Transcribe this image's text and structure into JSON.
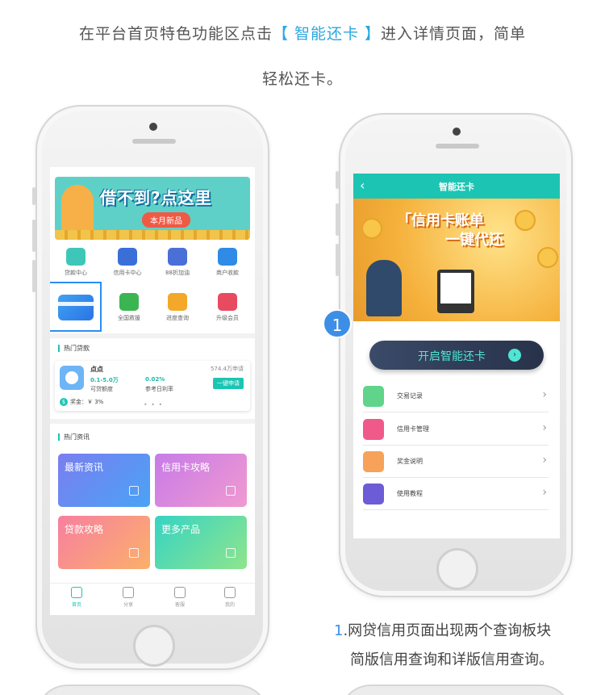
{
  "intro": {
    "line1_prefix": "在平台首页特色功能区点击",
    "line1_highlight": "【 智能还卡 】",
    "line1_suffix": "进入详情页面，简单",
    "line2": "轻松还卡。"
  },
  "phone1": {
    "banner": {
      "title": "借不到?点这里",
      "badge": "本月新品"
    },
    "grid": [
      {
        "label": "贷款中心",
        "icon": "loan-center-icon",
        "color": "#3ec7b9"
      },
      {
        "label": "信用卡中心",
        "icon": "credit-card-center-icon",
        "color": "#3b6fd8"
      },
      {
        "label": "88折加油",
        "icon": "fuel-icon",
        "color": "#4a6fd6"
      },
      {
        "label": "商户收款",
        "icon": "merchant-icon",
        "color": "#2f8be5"
      },
      {
        "label": "全国救援",
        "icon": "rescue-truck-icon",
        "color": "#3bb552"
      },
      {
        "label": "进度查询",
        "icon": "progress-query-icon",
        "color": "#f3a829"
      },
      {
        "label": "升级会员",
        "icon": "vip-diamond-icon",
        "color": "#e84a5f"
      }
    ],
    "hot_loans": {
      "title": "热门贷款",
      "card": {
        "name": "点点",
        "applications": "574.4万申请",
        "range": "0.1-5.0万",
        "range_label": "可贷额度",
        "rate": "0.02%",
        "rate_label": "参考日利率",
        "apply": "一键申请",
        "bonus": "奖金：￥ 3%",
        "dots": "• • •"
      }
    },
    "hot_news": {
      "title": "热门资讯",
      "tiles": [
        {
          "label": "最新资讯",
          "gradient": [
            "#7a7ef0",
            "#4aa3f5"
          ]
        },
        {
          "label": "信用卡攻略",
          "gradient": [
            "#c77be8",
            "#f09ad0"
          ]
        },
        {
          "label": "贷款攻略",
          "gradient": [
            "#f77fa0",
            "#fbb06a"
          ]
        },
        {
          "label": "更多产品",
          "gradient": [
            "#36d3c4",
            "#8fe58c"
          ]
        }
      ]
    },
    "tabs": [
      {
        "label": "首页",
        "active": true
      },
      {
        "label": "分享",
        "active": false
      },
      {
        "label": "客服",
        "active": false
      },
      {
        "label": "我的",
        "active": false
      }
    ]
  },
  "phone2": {
    "nav": {
      "back": "‹",
      "title": "智能还卡"
    },
    "banner": {
      "line1": "「信用卡账单",
      "line2": "一键代还"
    },
    "step_badge": "1",
    "open_button": {
      "label": "开启智能还卡",
      "arrow": "›"
    },
    "menu": [
      {
        "label": "交易记录",
        "icon": "transaction-record-icon",
        "color": "#5fd48a"
      },
      {
        "label": "信用卡管理",
        "icon": "card-manage-icon",
        "color": "#f05a8a"
      },
      {
        "label": "奖金说明",
        "icon": "bonus-info-icon",
        "color": "#f6a25a"
      },
      {
        "label": "使用教程",
        "icon": "tutorial-icon",
        "color": "#6c5cd6"
      }
    ],
    "chevron": "›"
  },
  "caption": {
    "num": "1",
    "line1": ".网贷信用页面出现两个查询板块",
    "line2": "简版信用查询和详版信用查询。"
  }
}
